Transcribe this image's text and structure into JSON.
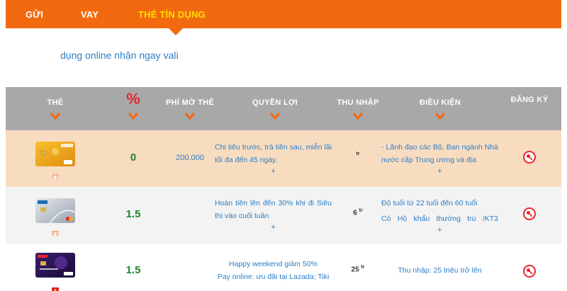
{
  "tabs": [
    {
      "label": "GỬI",
      "active": false
    },
    {
      "label": "VAY",
      "active": false
    },
    {
      "label": "THẺ TÍN DỤNG",
      "active": true
    }
  ],
  "marquee": "dụng online nhận ngay vali",
  "colors": {
    "accent": "#f26a0f",
    "active_tab": "#ffe000",
    "link": "#2a7fc8",
    "rate": "#1a8a2a",
    "red": "#e8282e"
  },
  "table": {
    "headers": {
      "card": "THẺ",
      "rate": "%",
      "fee": "PHÍ MỞ THẺ",
      "benefit": "QUYỀN LỢI",
      "income": "THU NHẬP",
      "condition": "ĐIỀU KIỆN",
      "register": "ĐĂNG KÝ"
    },
    "rows": [
      {
        "rate": "0",
        "fee": "200.000",
        "benefit": "Chi tiêu trước, trả tiền sau, miễn lãi tối đa đến 45 ngày.",
        "benefit_more": "+",
        "income": "",
        "income_unit": "tr",
        "condition": "- Lãnh đạo các Bộ, Ban ngành Nhà nước cấp Trung ương và địa",
        "condition_more": "+",
        "register_icon": "key-icon"
      },
      {
        "rate": "1.5",
        "fee": "",
        "benefit": "Hoàn tiền lên đến 30% khi đi Siêu thị vào cuối tuần",
        "benefit_more": "+",
        "income": "6",
        "income_unit": "tr",
        "condition": "Độ tuổi từ 22 tuổi đến 60 tuổi",
        "condition2": "Có Hộ khẩu thường trú /KT3",
        "condition_more": "+",
        "register_icon": "key-icon"
      },
      {
        "rate": "1.5",
        "fee": "",
        "benefit": "Happy weekend giảm 50%",
        "benefit2": "Pay online: ưu đãi tại Lazada; Tiki",
        "income": "25",
        "income_unit": "tr",
        "condition": "Thu nhập: 25 triệu trở lên",
        "register_icon": "key-icon"
      }
    ]
  }
}
